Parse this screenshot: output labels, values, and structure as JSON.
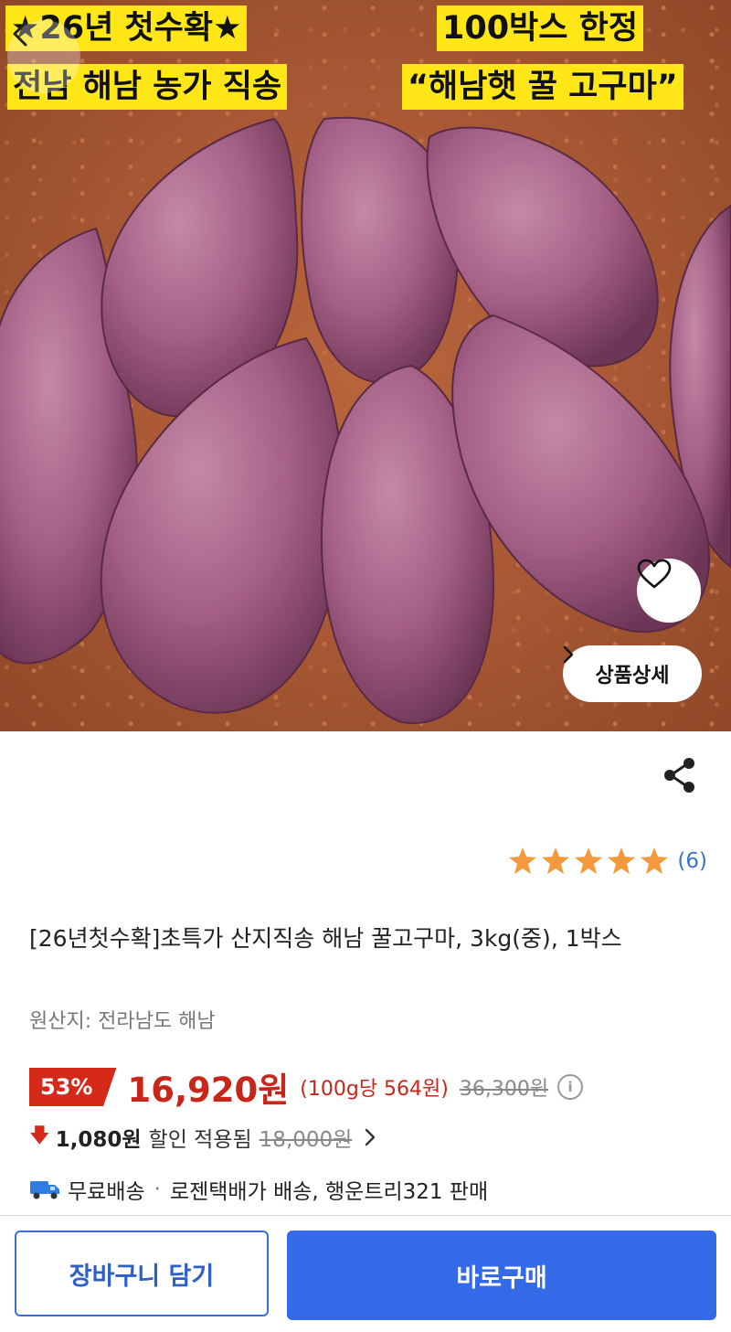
{
  "hero": {
    "banners": {
      "top_left_line1": "★26년 첫수확★",
      "top_left_line2": "전남 해남 농가 직송",
      "top_right_line1": "100박스 한정",
      "top_right_line2": "“해남햇 꿀 고구마”"
    },
    "detail_button": "상품상세"
  },
  "product": {
    "rating_count": "(6)",
    "rating_stars": 5,
    "title": "[26년첫수확]초특가 산지직송 해남 꿀고구마, 3kg(중), 1박스",
    "origin": "원산지: 전라남도 해남",
    "discount_badge": "53%",
    "price": "16,920원",
    "unit_price": "(100g당 564원)",
    "original_price": "36,300원",
    "extra_discount_amount": "1,080원",
    "extra_discount_label": "할인 적용됨",
    "extra_discount_original": "18,000원",
    "shipping_free": "무료배송",
    "shipping_separator": "·",
    "shipping_detail": "로젠택배가 배송, 행운트리321 판매"
  },
  "actions": {
    "cart_button": "장바구니 담기",
    "buy_button": "바로구매"
  },
  "colors": {
    "accent_blue": "#3469e8",
    "sale_red": "#c8261a",
    "star_orange": "#f59a3c",
    "banner_yellow": "#ffe617"
  }
}
